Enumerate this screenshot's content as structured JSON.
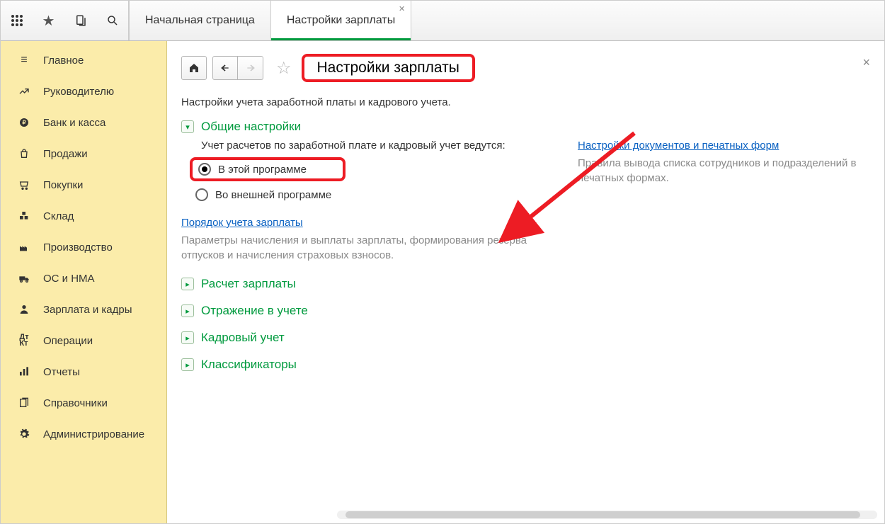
{
  "tabs": {
    "home_label": "Начальная страница",
    "active_label": "Настройки зарплаты"
  },
  "sidebar": {
    "items": [
      {
        "icon": "menu",
        "label": "Главное"
      },
      {
        "icon": "trend",
        "label": "Руководителю"
      },
      {
        "icon": "ruble",
        "label": "Банк и касса"
      },
      {
        "icon": "bag",
        "label": "Продажи"
      },
      {
        "icon": "cart",
        "label": "Покупки"
      },
      {
        "icon": "boxes",
        "label": "Склад"
      },
      {
        "icon": "factory",
        "label": "Производство"
      },
      {
        "icon": "truck",
        "label": "ОС и НМА"
      },
      {
        "icon": "person",
        "label": "Зарплата и кадры"
      },
      {
        "icon": "ledger",
        "label": "Операции"
      },
      {
        "icon": "bars",
        "label": "Отчеты"
      },
      {
        "icon": "books",
        "label": "Справочники"
      },
      {
        "icon": "gear",
        "label": "Администрирование"
      }
    ]
  },
  "page": {
    "title": "Настройки зарплаты",
    "subtitle": "Настройки учета заработной платы и кадрового учета."
  },
  "general": {
    "header": "Общие настройки",
    "lead": "Учет расчетов по заработной плате и кадровый учет ведутся:",
    "radio_in_program": "В этой программе",
    "radio_external": "Во внешней программе",
    "selected": "in_program",
    "order_link": "Порядок учета зарплаты",
    "order_desc": "Параметры начисления и выплаты зарплаты, формирования резерва отпусков и начисления страховых взносов."
  },
  "right": {
    "doc_link": "Настройки документов и печатных форм",
    "doc_desc": "Правила вывода списка сотрудников и подразделений в печатных формах."
  },
  "sections": {
    "calc": "Расчет зарплаты",
    "reflect": "Отражение в учете",
    "hr": "Кадровый учет",
    "classifiers": "Классификаторы"
  }
}
